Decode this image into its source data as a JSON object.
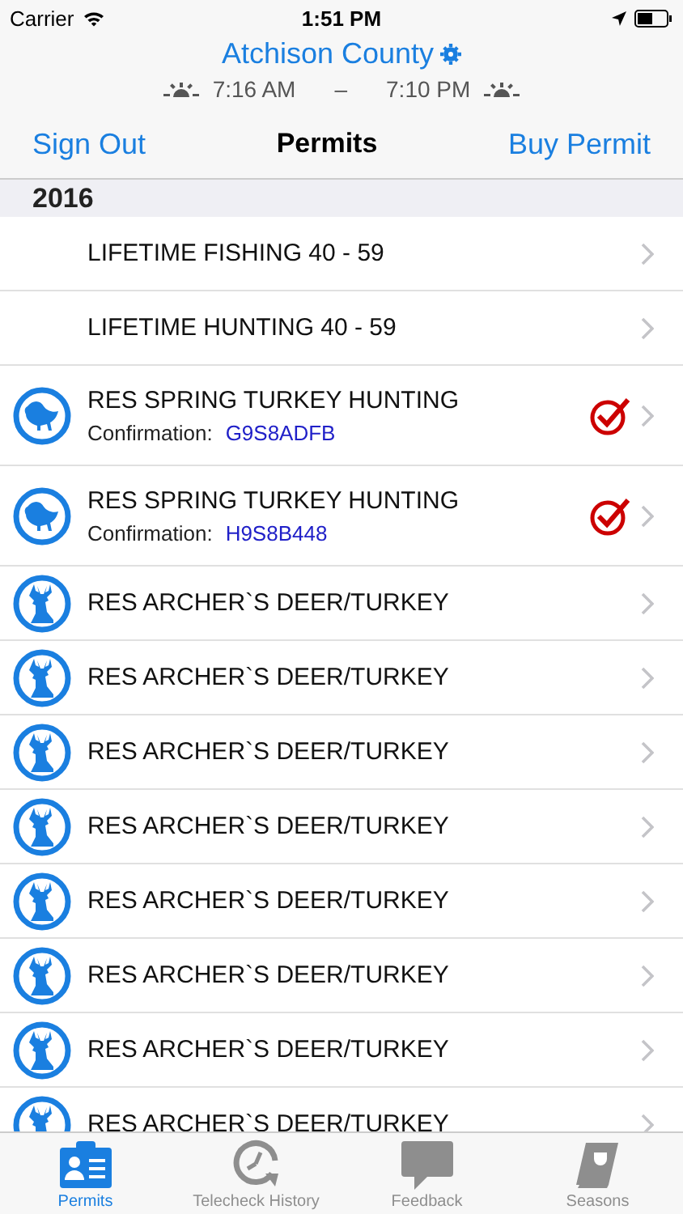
{
  "status_bar": {
    "carrier": "Carrier",
    "time": "1:51 PM"
  },
  "header": {
    "county": "Atchison County",
    "sunrise": "7:16 AM",
    "dash": "–",
    "sunset": "7:10 PM"
  },
  "nav": {
    "left": "Sign Out",
    "title": "Permits",
    "right": "Buy Permit"
  },
  "section": "2016",
  "rows": [
    {
      "kind": "plain",
      "title": "LIFETIME FISHING 40 - 59",
      "checked": false
    },
    {
      "kind": "plain",
      "title": "LIFETIME HUNTING 40 - 59",
      "checked": false
    },
    {
      "kind": "turkey",
      "title": "RES SPRING TURKEY HUNTING",
      "confirmation_label": "Confirmation:",
      "confirmation": "G9S8ADFB",
      "checked": true
    },
    {
      "kind": "turkey",
      "title": "RES SPRING TURKEY HUNTING",
      "confirmation_label": "Confirmation:",
      "confirmation": "H9S8B448",
      "checked": true
    },
    {
      "kind": "deer",
      "title": "RES ARCHER`S DEER/TURKEY",
      "checked": false
    },
    {
      "kind": "deer",
      "title": "RES ARCHER`S DEER/TURKEY",
      "checked": false
    },
    {
      "kind": "deer",
      "title": "RES ARCHER`S DEER/TURKEY",
      "checked": false
    },
    {
      "kind": "deer",
      "title": "RES ARCHER`S DEER/TURKEY",
      "checked": false
    },
    {
      "kind": "deer",
      "title": "RES ARCHER`S DEER/TURKEY",
      "checked": false
    },
    {
      "kind": "deer",
      "title": "RES ARCHER`S DEER/TURKEY",
      "checked": false
    },
    {
      "kind": "deer",
      "title": "RES ARCHER`S DEER/TURKEY",
      "checked": false
    },
    {
      "kind": "deer",
      "title": "RES ARCHER`S DEER/TURKEY",
      "checked": false
    }
  ],
  "tabs": [
    {
      "kind": "permits",
      "label": "Permits",
      "selected": true
    },
    {
      "kind": "history",
      "label": "Telecheck History",
      "selected": false
    },
    {
      "kind": "feedback",
      "label": "Feedback",
      "selected": false
    },
    {
      "kind": "seasons",
      "label": "Seasons",
      "selected": false
    }
  ]
}
